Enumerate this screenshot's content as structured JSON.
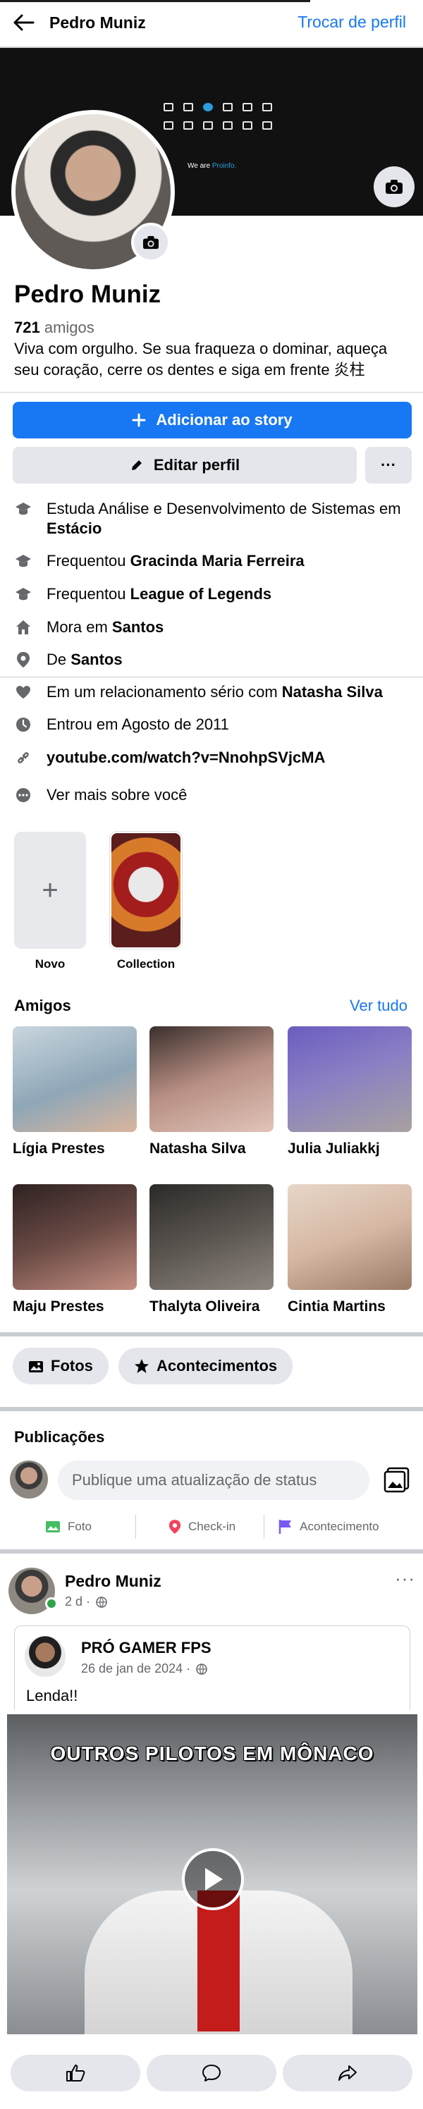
{
  "header": {
    "title": "Pedro Muniz",
    "switch_profile": "Trocar de perfil"
  },
  "cover": {
    "tagline_prefix": "We are",
    "tagline_brand": "Proinfo."
  },
  "profile": {
    "name": "Pedro Muniz",
    "friends_number": "721",
    "friends_label": "amigos",
    "bio": "Viva com orgulho. Se sua fraqueza o dominar, aqueça seu coração, cerre os dentes e siga em frente 炎柱"
  },
  "buttons": {
    "add_story": "Adicionar ao story",
    "edit_profile": "Editar perfil",
    "more": "···"
  },
  "details": [
    {
      "prefix": "Estuda Análise e Desenvolvimento de Sistemas em ",
      "bold": "Estácio",
      "icon": "graduation-cap-icon"
    },
    {
      "prefix": "Frequentou ",
      "bold": "Gracinda Maria Ferreira",
      "icon": "graduation-cap-icon"
    },
    {
      "prefix": "Frequentou ",
      "bold": "League of Legends",
      "icon": "graduation-cap-icon"
    },
    {
      "prefix": "Mora em ",
      "bold": "Santos",
      "icon": "home-icon"
    },
    {
      "prefix": "De ",
      "bold": "Santos",
      "icon": "location-pin-icon"
    },
    {
      "prefix": "Em um relacionamento sério com ",
      "bold": "Natasha Silva",
      "icon": "heart-icon"
    },
    {
      "prefix": "Entrou em Agosto de 2011",
      "bold": "",
      "icon": "clock-icon"
    },
    {
      "prefix": "",
      "bold": "youtube.com/watch?v=NnohpSVjcMA",
      "icon": "link-icon"
    },
    {
      "prefix": "Ver mais sobre você",
      "bold": "",
      "icon": "more-circle-icon"
    }
  ],
  "highlights": [
    {
      "label": "Novo",
      "symbol": "+"
    },
    {
      "label": "Collection"
    }
  ],
  "friends_section": {
    "title": "Amigos",
    "see_all": "Ver tudo",
    "friends": [
      {
        "name": "Lígia Prestes",
        "color": "#8fa7b8"
      },
      {
        "name": "Natasha Silva",
        "color": "#b88f84"
      },
      {
        "name": "Julia Juliakkj",
        "color": "#8a7fc4"
      },
      {
        "name": "Maju Prestes",
        "color": "#6a4a45"
      },
      {
        "name": "Thalyta Oliveira",
        "color": "#5b5550"
      },
      {
        "name": "Cintia Martins",
        "color": "#d6b8a4"
      }
    ]
  },
  "chips": {
    "photos": "Fotos",
    "events": "Acontecimentos"
  },
  "publications": {
    "title": "Publicações",
    "composer_placeholder": "Publique uma atualização de status",
    "actions": {
      "photo": "Foto",
      "checkin": "Check-in",
      "event": "Acontecimento"
    }
  },
  "post": {
    "author": "Pedro Muniz",
    "time": "2 d ·",
    "more": "···",
    "shared": {
      "author": "PRÓ GAMER FPS",
      "time": "26 de jan de 2024 ·",
      "text": "Lenda!!"
    },
    "video_title": "OUTROS PILOTOS EM MÔNACO"
  },
  "colors": {
    "accent": "#1877f2",
    "button_gray": "#e4e6eb",
    "online": "#31a24c"
  }
}
